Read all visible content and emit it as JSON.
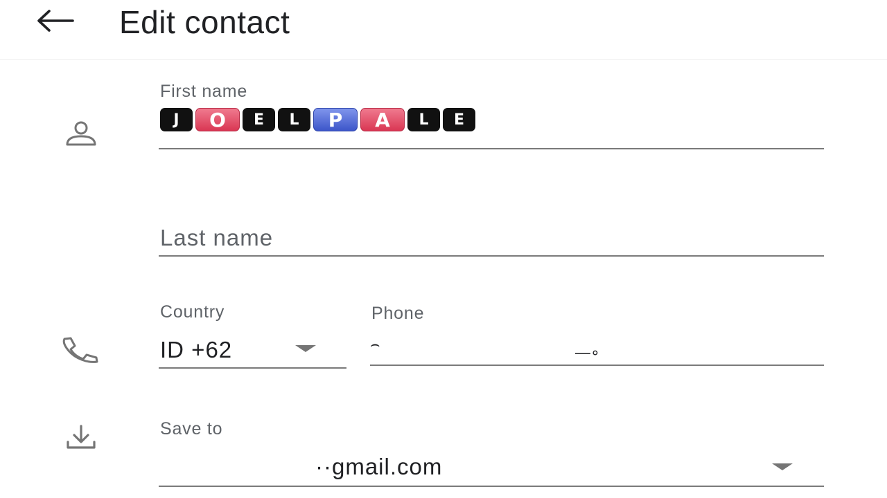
{
  "header": {
    "back_icon": "arrow-left-icon",
    "title": "Edit contact"
  },
  "first_name": {
    "label": "First name",
    "icon": "person-icon",
    "tiles": [
      {
        "letter": "J",
        "style": "dark"
      },
      {
        "letter": "O",
        "style": "red"
      },
      {
        "letter": "E",
        "style": "dark"
      },
      {
        "letter": "L",
        "style": "dark"
      },
      {
        "letter": "P",
        "style": "blue"
      },
      {
        "letter": "A",
        "style": "red"
      },
      {
        "letter": "L",
        "style": "dark"
      },
      {
        "letter": "E",
        "style": "dark"
      }
    ]
  },
  "last_name": {
    "placeholder": "Last name"
  },
  "phone_section": {
    "icon": "phone-icon",
    "country_label": "Country",
    "country_value": "ID +62",
    "phone_label": "Phone",
    "phone_fragment_start": "⌢",
    "phone_fragment_end": "—∘"
  },
  "save_to": {
    "icon": "download-icon",
    "label": "Save to",
    "value": "··gmail.com"
  },
  "colors": {
    "text_primary": "#202124",
    "text_secondary": "#5f6368",
    "underline": "#7a7a7a",
    "icon": "#757575",
    "tile_dark": "#111111",
    "tile_red": "#d93753",
    "tile_blue": "#3d56c9"
  }
}
